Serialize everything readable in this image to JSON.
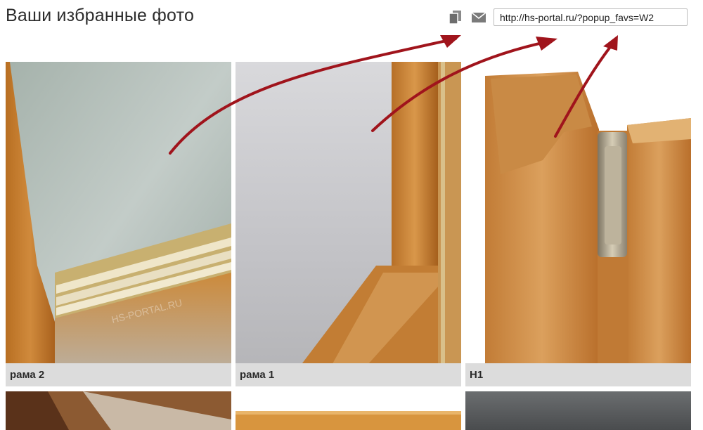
{
  "header": {
    "title": "Ваши избранные фото",
    "share_url": "http://hs-portal.ru/?popup_favs=W2"
  },
  "icons": {
    "copy": "copy-icon",
    "mail": "mail-icon"
  },
  "colors": {
    "caption_bg": "#dcdcdc",
    "arrow": "#a0141c"
  },
  "gallery": {
    "items": [
      {
        "caption": "рама 2",
        "watermark": "HS-PORTAL.RU"
      },
      {
        "caption": "рама 1"
      },
      {
        "caption": "H1"
      },
      {
        "caption": ""
      },
      {
        "caption": ""
      },
      {
        "caption": ""
      }
    ]
  }
}
